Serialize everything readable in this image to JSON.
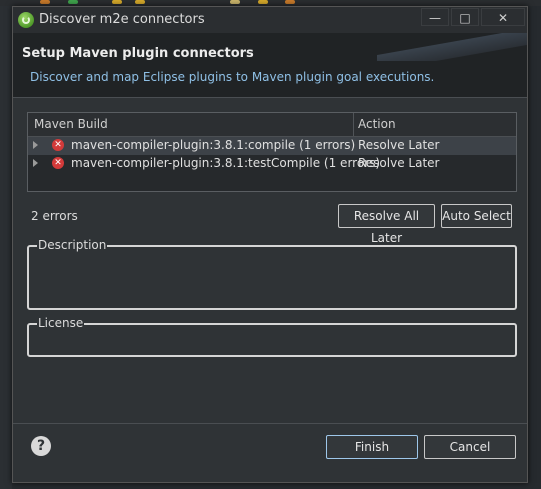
{
  "window": {
    "title": "Discover m2e connectors",
    "controls": {
      "minimize": "—",
      "maximize": "□",
      "close": "✕"
    }
  },
  "banner": {
    "title": "Setup Maven plugin connectors",
    "description": "Discover and map Eclipse plugins to Maven plugin goal executions."
  },
  "table": {
    "columns": [
      "Maven Build",
      "Action"
    ],
    "rows": [
      {
        "name": "maven-compiler-plugin:3.8.1:compile (1 errors)",
        "action": "Resolve Later",
        "selected": true
      },
      {
        "name": "maven-compiler-plugin:3.8.1:testCompile (1 errors)",
        "action": "Resolve Later",
        "selected": false
      }
    ]
  },
  "status": {
    "error_count": "2 errors"
  },
  "buttons": {
    "resolve_all_later": "Resolve All Later",
    "auto_select": "Auto Select",
    "finish": "Finish",
    "cancel": "Cancel",
    "help": "?"
  },
  "groups": {
    "description": "Description",
    "license": "License"
  },
  "colors": {
    "accent_link": "#8fc0e6",
    "error": "#d33a3a",
    "dialog_bg": "#2f3336"
  },
  "icons": {
    "window": "spring-leaf-icon",
    "row_status": "error-icon",
    "help": "help-icon"
  }
}
